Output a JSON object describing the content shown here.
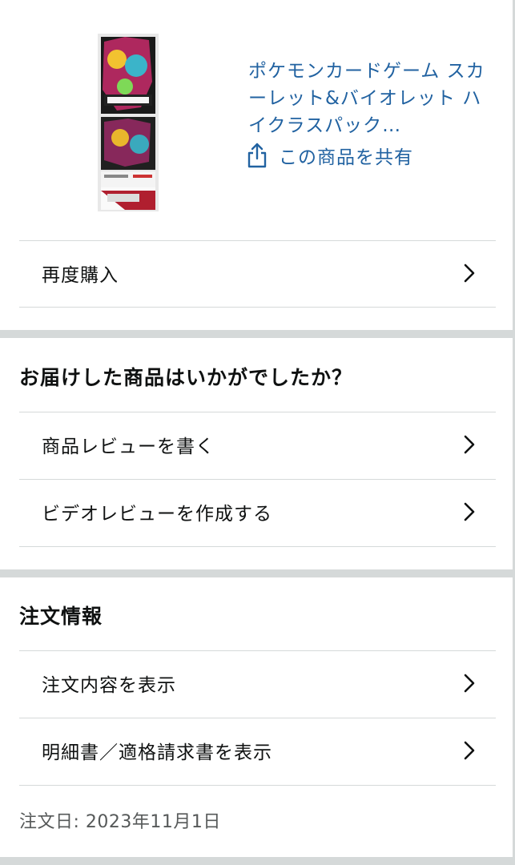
{
  "product": {
    "title": "ポケモンカードゲーム スカーレット&バイオレット ハイクラスパック…",
    "image_icon": "product-box-image",
    "share_label": "この商品を共有",
    "share_icon": "share-icon"
  },
  "actions": {
    "buy_again": "再度購入"
  },
  "review_section": {
    "heading": "お届けした商品はいかがでしたか？",
    "write_review": "商品レビューを書く",
    "video_review": "ビデオレビューを作成する"
  },
  "order_section": {
    "heading": "注文情報",
    "view_order": "注文内容を表示",
    "view_invoice": "明細書／適格請求書を表示",
    "order_date": "注文日: 2023年11月1日"
  },
  "colors": {
    "link": "#2162a1",
    "text": "#0f1111",
    "muted": "#565959",
    "divider": "#d5d9d9"
  }
}
